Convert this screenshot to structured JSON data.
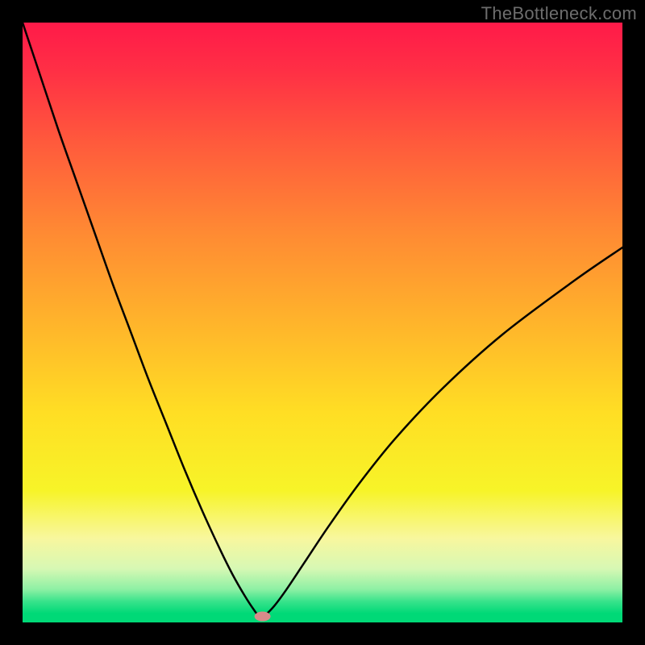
{
  "watermark": "TheBottleneck.com",
  "chart_data": {
    "type": "line",
    "title": "",
    "xlabel": "",
    "ylabel": "",
    "xlim": [
      0,
      100
    ],
    "ylim": [
      0,
      100
    ],
    "grid": false,
    "legend": false,
    "annotations": [],
    "gradient_stops": [
      {
        "offset": 0.0,
        "color": "#ff1a49"
      },
      {
        "offset": 0.08,
        "color": "#ff2f45"
      },
      {
        "offset": 0.2,
        "color": "#ff5a3c"
      },
      {
        "offset": 0.35,
        "color": "#ff8a33"
      },
      {
        "offset": 0.5,
        "color": "#ffb42b"
      },
      {
        "offset": 0.65,
        "color": "#ffde24"
      },
      {
        "offset": 0.78,
        "color": "#f7f428"
      },
      {
        "offset": 0.86,
        "color": "#f8f79e"
      },
      {
        "offset": 0.91,
        "color": "#d7f8b4"
      },
      {
        "offset": 0.945,
        "color": "#8df0a4"
      },
      {
        "offset": 0.965,
        "color": "#38e38b"
      },
      {
        "offset": 0.985,
        "color": "#00d977"
      },
      {
        "offset": 1.0,
        "color": "#00d977"
      }
    ],
    "series": [
      {
        "name": "bottleneck-curve",
        "x": [
          0,
          3,
          6,
          9,
          12,
          15,
          18,
          21,
          24,
          27,
          30,
          33,
          35,
          37,
          38.5,
          39.5,
          40.5,
          42,
          44,
          47,
          51,
          56,
          62,
          70,
          80,
          92,
          100
        ],
        "y": [
          100,
          91,
          82,
          73.5,
          65,
          56.5,
          48.5,
          40.5,
          33,
          25.5,
          18.5,
          12,
          8,
          4.5,
          2.2,
          1.0,
          1.3,
          2.8,
          5.5,
          10,
          16,
          23,
          30.5,
          39,
          48,
          57,
          62.5
        ]
      }
    ],
    "marker": {
      "x": 40,
      "y": 1.0,
      "color": "#d98a8a",
      "rx": 10,
      "ry": 6
    }
  }
}
